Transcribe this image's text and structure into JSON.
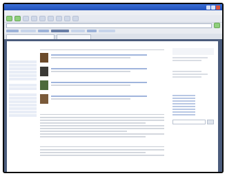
{
  "browser": {
    "title": "",
    "menu": [],
    "address": "",
    "tabs": [
      {
        "label": "",
        "active": true
      },
      {
        "label": "",
        "active": false
      }
    ]
  },
  "page": {
    "logo_text": "",
    "sidebar_items": [],
    "heading": "",
    "section_1_title": "",
    "section_2_title": "",
    "right_title": ""
  }
}
